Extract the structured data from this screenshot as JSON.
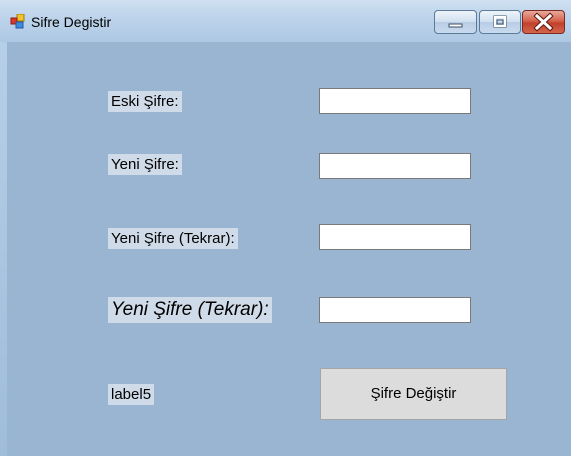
{
  "window": {
    "title": "Sifre Degistir"
  },
  "form": {
    "label_old": "Eski Şifre:",
    "label_new": "Yeni Şifre:",
    "label_repeat": "Yeni Şifre (Tekrar):",
    "label_repeat_big": "Yeni Şifre (Tekrar):",
    "label5": "label5",
    "old_value": "",
    "new_value": "",
    "repeat_value": "",
    "repeat2_value": "",
    "submit_label": "Şifre Değiştir"
  }
}
